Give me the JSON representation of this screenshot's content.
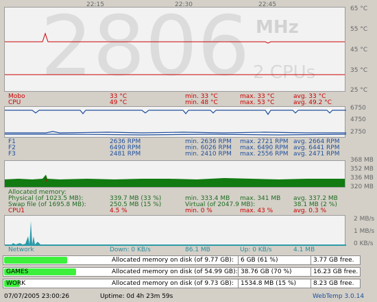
{
  "time_axis": [
    "22:15",
    "22:30",
    "22:45"
  ],
  "watermark": {
    "value": "2806",
    "unit": "MHz",
    "cpus": "2 CPUs"
  },
  "temp": {
    "axis": [
      "65 °C",
      "55 °C",
      "45 °C",
      "35 °C",
      "25 °C"
    ],
    "rows": [
      {
        "name": "Mobo",
        "cur": "33 °C",
        "min": "min. 33 °C",
        "max": "max. 33 °C",
        "avg": "avg. 33 °C"
      },
      {
        "name": "CPU",
        "cur": "49 °C",
        "min": "min. 48 °C",
        "max": "max. 53 °C",
        "avg": "avg. 49.2 °C"
      }
    ]
  },
  "fans": {
    "axis": [
      "6750",
      "4750",
      "2750"
    ],
    "rows": [
      {
        "name": "F1",
        "cur": "2636 RPM",
        "min": "min. 2636 RPM",
        "max": "max. 2721 RPM",
        "avg": "avg. 2664 RPM"
      },
      {
        "name": "F2",
        "cur": "6490 RPM",
        "min": "min. 6026 RPM",
        "max": "max. 6490 RPM",
        "avg": "avg. 6441 RPM"
      },
      {
        "name": "F3",
        "cur": "2481 RPM",
        "min": "min. 2410 RPM",
        "max": "max. 2556 RPM",
        "avg": "avg. 2471 RPM"
      }
    ]
  },
  "memory": {
    "axis": [
      "368 MB",
      "352 MB",
      "336 MB",
      "320 MB"
    ],
    "title": "Allocated memory:",
    "physical": {
      "label": "Physical (of 1023.5 MB):",
      "cur": "339.7 MB (33 %)",
      "min": "min. 333.4 MB",
      "max": "max. 341 MB",
      "avg": "avg. 337.2 MB"
    },
    "swap": {
      "label": "Swap file (of 1695.8 MB):",
      "cur": "250.5 MB (15 %)",
      "virtual": "Virtual (of 2047.9 MB):",
      "vcur": "38.1 MB (2 %)"
    },
    "cpu1": {
      "label": "CPU1",
      "cur": "4.5 %",
      "min": "min. 0 %",
      "max": "max. 43 %",
      "avg": "avg. 0.3 %"
    }
  },
  "network": {
    "axis": [
      "2 MB/s",
      "1 MB/s",
      "0 KB/s"
    ],
    "label": "Network",
    "down": "Down: 0 KB/s",
    "down_total": "86.1 MB",
    "up": "Up: 0 KB/s",
    "up_total": "4.1 MB"
  },
  "disks": [
    {
      "name": "",
      "label": "Allocated memory on disk (of 9.77 GB):",
      "used": "6 GB (61 %)",
      "free": "3.77 GB free.",
      "fraction": 0.61
    },
    {
      "name": "GAMES",
      "label": "Allocated memory on disk (of 54.99 GB):",
      "used": "38.76 GB (70 %)",
      "free": "16.23 GB free.",
      "fraction": 0.7
    },
    {
      "name": "WORK",
      "label": "Allocated memory on disk (of 9.73 GB):",
      "used": "1534.8 MB (15 %)",
      "free": "8.23 GB free.",
      "fraction": 0.15
    }
  ],
  "status": {
    "datetime": "07/07/2005 23:00:26",
    "uptime": "Uptime: 0d 4h 23m 59s",
    "app": "WebTemp 3.0.14"
  },
  "colors": {
    "temp": "#cc0000",
    "fans": "#1f4e9c",
    "memory": "#117a11",
    "network": "#2a9aa8",
    "disk": "#3cf03c"
  }
}
